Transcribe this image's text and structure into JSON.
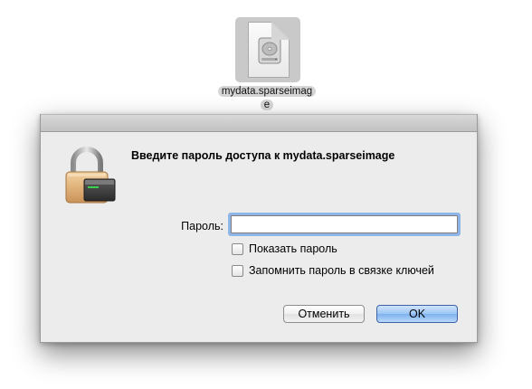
{
  "desktop": {
    "file": {
      "icon": "disk-image-icon",
      "name_line1": "mydata.sparseimag",
      "name_line2": "e"
    }
  },
  "dialog": {
    "icon": "lock-icon",
    "title": "Введите пароль доступа к mydata.sparseimage",
    "password_label": "Пароль:",
    "password_value": "",
    "show_password_label": "Показать пароль",
    "show_password_checked": false,
    "remember_label": "Запомнить пароль в связке ключей",
    "remember_checked": false,
    "cancel_label": "Отменить",
    "ok_label": "OK"
  },
  "colors": {
    "dialog_bg": "#ececec",
    "focus_ring": "#8fb5e6",
    "default_button": "#9cc6f4"
  }
}
